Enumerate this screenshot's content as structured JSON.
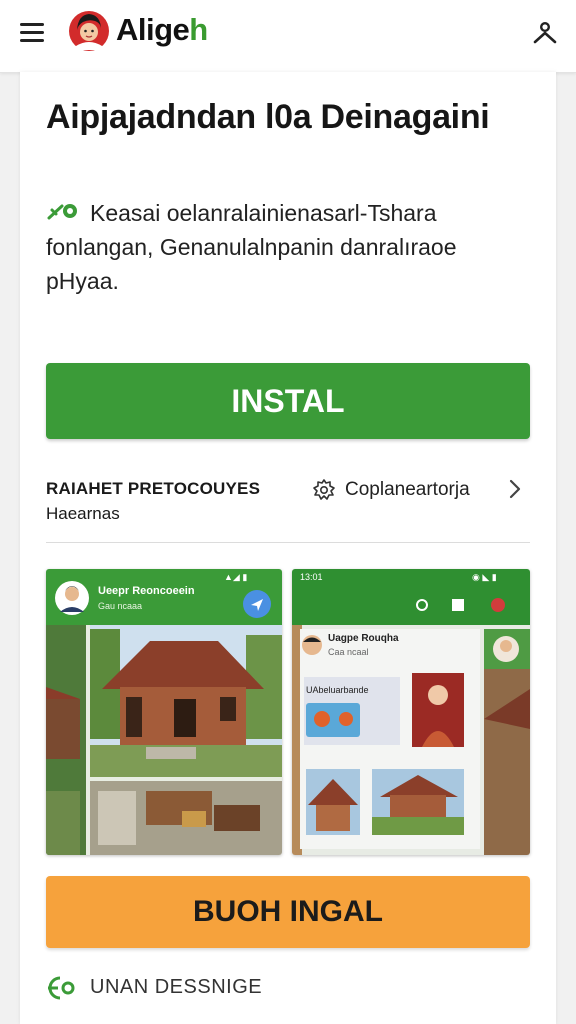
{
  "header": {
    "app_name_main": "Alige",
    "app_name_accent": "h",
    "menu_icon": "hamburger-menu-icon",
    "profile_icon": "user-icon"
  },
  "main": {
    "title": "Aipjajadndan l0a Deinagaini",
    "description": "Keasai oelanralainienasarl-Tshara fonlangan, Genanulalnpanin danralıraoe pHyaa.",
    "install_label": "INSTAL",
    "meta": {
      "category_line1": "RAIAHET PRETOCOUYES",
      "category_line2": "Haearnas",
      "developer_label": "Coplaneartorja"
    },
    "screenshots": {
      "shot1": {
        "status_icons": "▲◢ ▮",
        "profile_name": "Ueepr Reoncoeein",
        "profile_sub": "Gau ncaaa"
      },
      "shot2": {
        "status_time": "13:01",
        "status_icons": "◉ ◣ ▮",
        "profile_name": "Uagpe Rouqha",
        "profile_sub": "Caa ncaal",
        "card_title": "UAbeluarbande"
      }
    },
    "buy_label": "BUOH INGAL",
    "footer_label": "UNAN DESSNIGE"
  },
  "colors": {
    "primary_green": "#3b9b38",
    "accent_orange": "#f6a23c",
    "status_green": "#2f8f31"
  }
}
